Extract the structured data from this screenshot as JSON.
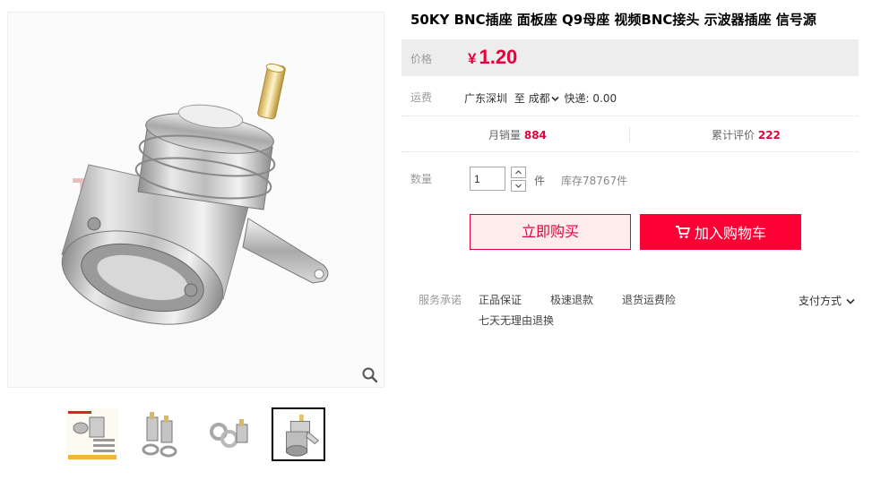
{
  "product": {
    "title": "50KY BNC插座 面板座 Q9母座 视频BNC接头 示波器插座 信号源",
    "watermark": "杰瀚",
    "zoom_icon": "magnifier-icon"
  },
  "price": {
    "label": "价格",
    "currency": "¥",
    "value": "1.20",
    "color": "#e4003b"
  },
  "shipping": {
    "label": "运费",
    "from": "广东深圳",
    "to_prefix": "至",
    "city": "成都",
    "express": "快递: 0.00"
  },
  "stats": {
    "sales_label": "月销量",
    "sales_value": "884",
    "reviews_label": "累计评价",
    "reviews_value": "222"
  },
  "quantity": {
    "label": "数量",
    "value": "1",
    "unit": "件",
    "stock": "库存78767件"
  },
  "buttons": {
    "buy_now": "立即购买",
    "add_cart": "加入购物车",
    "accent": "#ff0036"
  },
  "services": {
    "label": "服务承诺",
    "items": [
      "正品保证",
      "极速退款",
      "退货运费险",
      "七天无理由退换"
    ],
    "pay_method": "支付方式"
  },
  "thumbnails": [
    {
      "name": "thumb-product-package",
      "active": false
    },
    {
      "name": "thumb-connectors-side",
      "active": false
    },
    {
      "name": "thumb-connectors-washers",
      "active": false
    },
    {
      "name": "thumb-connector-single",
      "active": true
    }
  ]
}
